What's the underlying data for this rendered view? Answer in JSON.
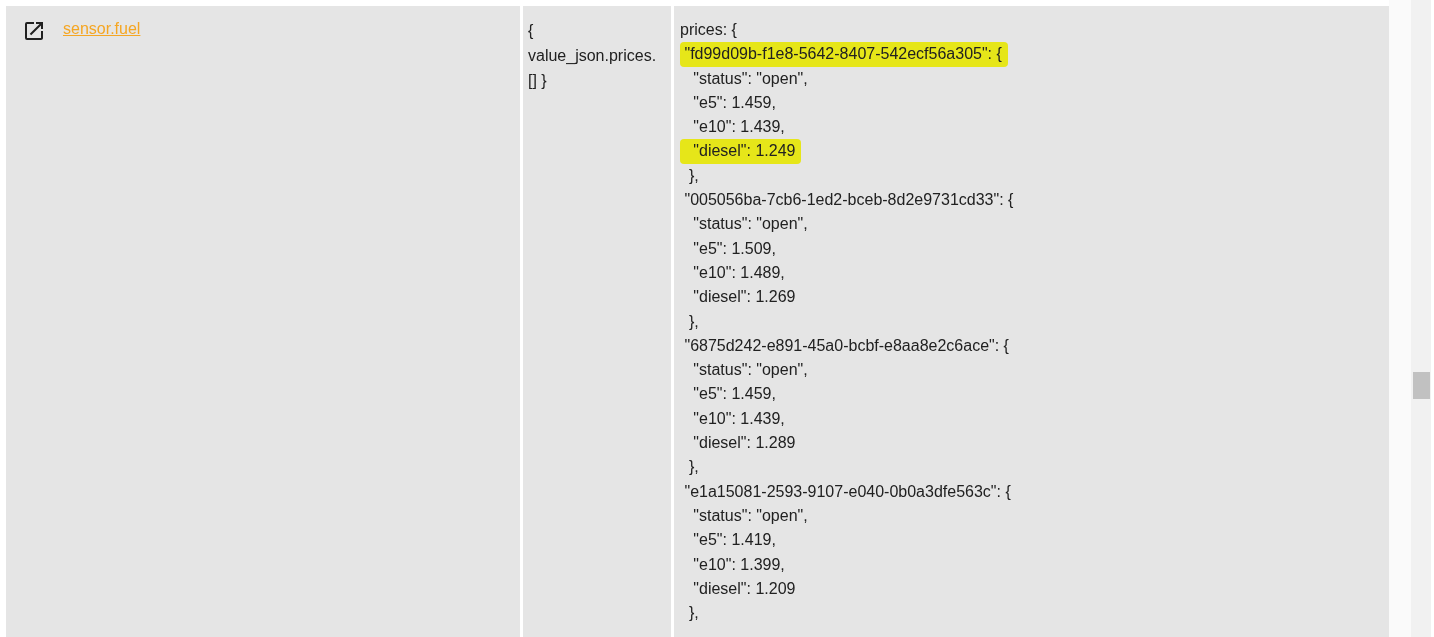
{
  "row": {
    "entity": {
      "label": "sensor.fuel"
    },
    "template_lines": [
      "{",
      "value_json.prices.",
      "[] }"
    ],
    "attribute_lines": [
      {
        "text": "prices: {",
        "highlighted": false
      },
      {
        "text": " \"fd99d09b-f1e8-5642-8407-542ecf56a305\": {",
        "highlighted": true
      },
      {
        "text": "   \"status\": \"open\",",
        "highlighted": false
      },
      {
        "text": "   \"e5\": 1.459,",
        "highlighted": false
      },
      {
        "text": "   \"e10\": 1.439,",
        "highlighted": false
      },
      {
        "text": "   \"diesel\": 1.249",
        "highlighted": true
      },
      {
        "text": "  },",
        "highlighted": false
      },
      {
        "text": " \"005056ba-7cb6-1ed2-bceb-8d2e9731cd33\": {",
        "highlighted": false
      },
      {
        "text": "   \"status\": \"open\",",
        "highlighted": false
      },
      {
        "text": "   \"e5\": 1.509,",
        "highlighted": false
      },
      {
        "text": "   \"e10\": 1.489,",
        "highlighted": false
      },
      {
        "text": "   \"diesel\": 1.269",
        "highlighted": false
      },
      {
        "text": "  },",
        "highlighted": false
      },
      {
        "text": " \"6875d242-e891-45a0-bcbf-e8aa8e2c6ace\": {",
        "highlighted": false
      },
      {
        "text": "   \"status\": \"open\",",
        "highlighted": false
      },
      {
        "text": "   \"e5\": 1.459,",
        "highlighted": false
      },
      {
        "text": "   \"e10\": 1.439,",
        "highlighted": false
      },
      {
        "text": "   \"diesel\": 1.289",
        "highlighted": false
      },
      {
        "text": "  },",
        "highlighted": false
      },
      {
        "text": " \"e1a15081-2593-9107-e040-0b0a3dfe563c\": {",
        "highlighted": false
      },
      {
        "text": "   \"status\": \"open\",",
        "highlighted": false
      },
      {
        "text": "   \"e5\": 1.419,",
        "highlighted": false
      },
      {
        "text": "   \"e10\": 1.399,",
        "highlighted": false
      },
      {
        "text": "   \"diesel\": 1.209",
        "highlighted": false
      },
      {
        "text": "  },",
        "highlighted": false
      }
    ]
  }
}
